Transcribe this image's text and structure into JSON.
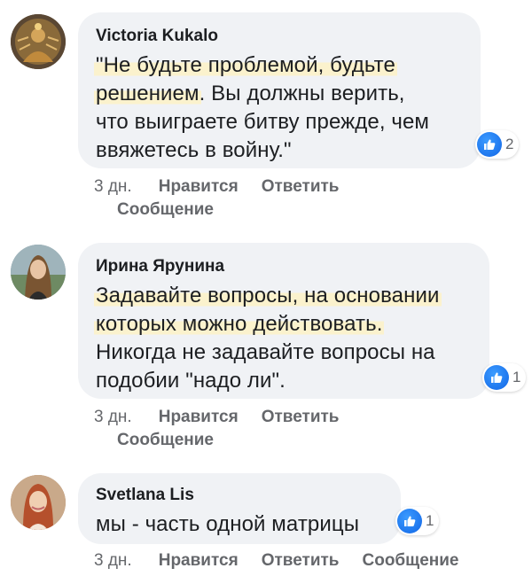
{
  "comments": [
    {
      "author": "Victoria Kukalo",
      "lines": [
        {
          "hl": "\"Не будьте проблемой, будьте",
          "rest": ""
        },
        {
          "hl": "решением",
          "rest": ". Вы должны верить,"
        },
        {
          "hl": "",
          "rest": "что выиграете битву прежде, чем"
        },
        {
          "hl": "",
          "rest": "ввяжетесь в войну.\""
        }
      ],
      "reaction_count": "2",
      "time": "3 дн.",
      "like": "Нравится",
      "reply": "Ответить",
      "message": "Сообщение"
    },
    {
      "author": "Ирина Ярунина",
      "lines": [
        {
          "hl": "Задавайте вопросы, на основании",
          "rest": ""
        },
        {
          "hl": "которых можно действовать.",
          "rest": ""
        },
        {
          "hl": "",
          "rest": "Никогда не задавайте вопросы на"
        },
        {
          "hl": "",
          "rest": "подобии \"надо ли\"."
        }
      ],
      "reaction_count": "1",
      "time": "3 дн.",
      "like": "Нравится",
      "reply": "Ответить",
      "message": "Сообщение"
    },
    {
      "author": "Svetlana Lis",
      "lines": [
        {
          "hl": "",
          "rest": "мы - часть одной матрицы"
        }
      ],
      "reaction_count": "1",
      "time": "3 дн.",
      "like": "Нравится",
      "reply": "Ответить",
      "message": "Сообщение"
    }
  ],
  "colors": {
    "bubble": "#f0f2f5",
    "highlight": "#fbf2cd",
    "like_blue": "#1877f2",
    "meta_text": "#65676b"
  },
  "icons": {
    "reaction": "thumbs-up-icon"
  }
}
